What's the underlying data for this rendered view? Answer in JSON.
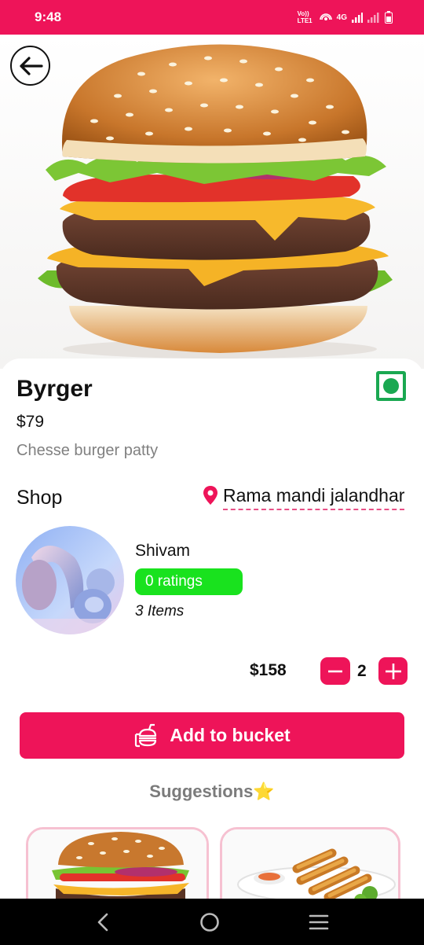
{
  "status_bar": {
    "time": "9:48",
    "network_label": "4G",
    "carrier_label": "Vo)) LTE1"
  },
  "product": {
    "name": "Byrger",
    "price": "$79",
    "description": "Chesse burger patty",
    "veg_indicator": "veg-mark-icon"
  },
  "shop": {
    "label": "Shop",
    "location": "Rama mandi jalandhar",
    "seller_name": "Shivam",
    "ratings": "0 ratings",
    "items": "3 Items"
  },
  "cart": {
    "total": "$158",
    "quantity": "2"
  },
  "add_button": {
    "label": "Add to bucket"
  },
  "suggestions": {
    "heading": "Suggestions⭐"
  },
  "colors": {
    "primary": "#ee1459",
    "veg_green": "#1aa851",
    "ratings_green": "#19e21e",
    "muted_text": "#808080"
  }
}
